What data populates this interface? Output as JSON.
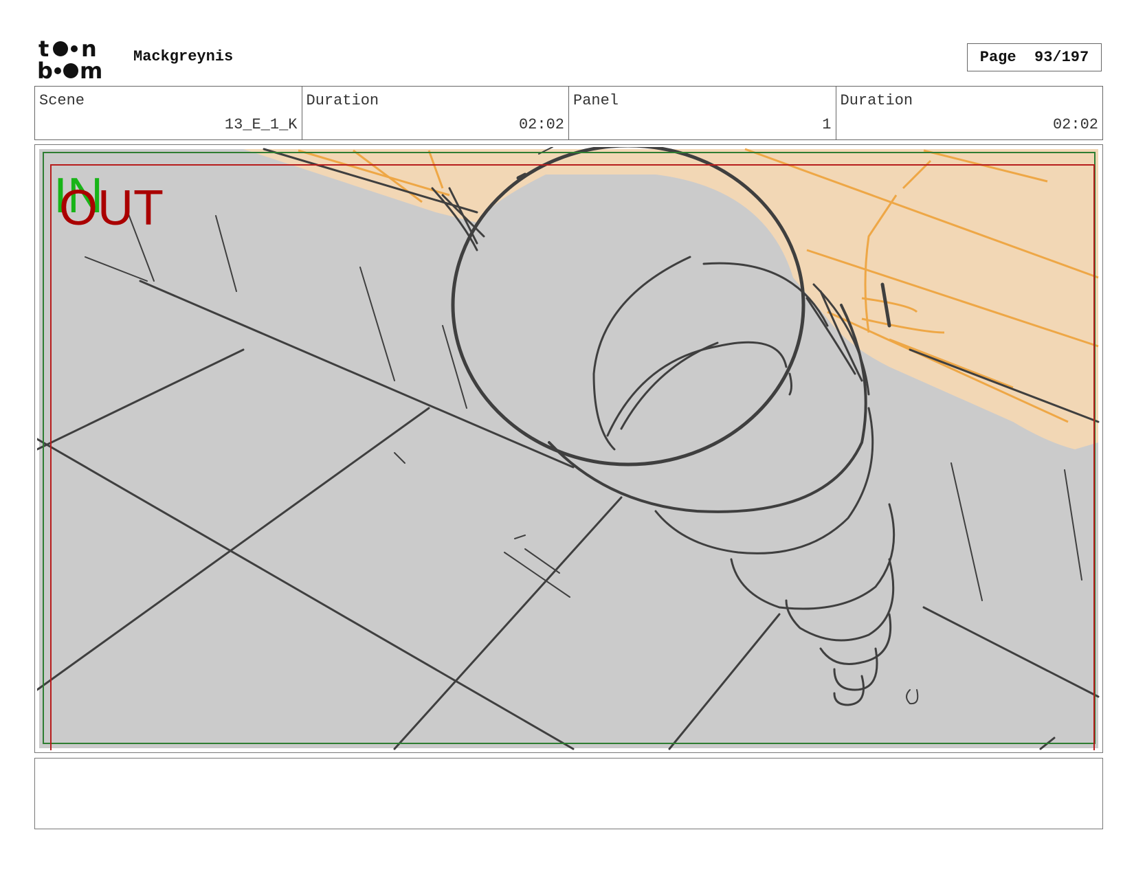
{
  "header": {
    "logo_text": "toon boom",
    "project_title": "Mackgreynis",
    "page_label": "Page",
    "page_value": "93/197"
  },
  "info": [
    {
      "label": "Scene",
      "value": "13_E_1_K"
    },
    {
      "label": "Duration",
      "value": "02:02"
    },
    {
      "label": "Panel",
      "value": "1"
    },
    {
      "label": "Duration",
      "value": "02:02"
    }
  ],
  "panel": {
    "in_label": "IN",
    "out_label": "OUT",
    "colors": {
      "background": "#cbcbcb",
      "skin": "#f2d7b5",
      "orange_stroke": "#eea23a",
      "line": "#3f3f3f",
      "in_frame": "#2e7d32",
      "out_frame": "#b71c1c",
      "in_text": "#18b418",
      "out_text": "#aa0000"
    }
  },
  "notes": {
    "text": ""
  }
}
